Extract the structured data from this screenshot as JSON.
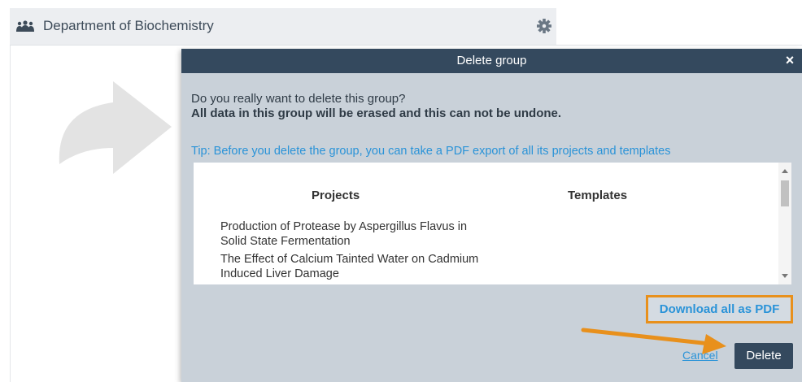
{
  "header": {
    "org_name": "Department of Biochemistry",
    "org_icon": "users-group-icon",
    "settings_icon": "gear-icon"
  },
  "dialog": {
    "title": "Delete group",
    "close_label": "×",
    "question": "Do you really want to delete this group?",
    "warning": "All data in this group will be erased and this can not be undone.",
    "tip": "Tip: Before you delete the group, you can take a PDF export of all its projects and templates",
    "columns": {
      "projects": "Projects",
      "templates": "Templates"
    },
    "projects": [
      "Production of Protease by Aspergillus Flavus in Solid State Fermentation",
      "The Effect of Calcium Tainted Water on Cadmium Induced Liver Damage"
    ],
    "templates": [],
    "download_label": "Download all as PDF",
    "cancel_label": "Cancel",
    "delete_label": "Delete"
  },
  "colors": {
    "header_bg": "#34495e",
    "dialog_bg": "#c9d1d9",
    "link": "#2a93d8",
    "highlight": "#e8901c"
  }
}
